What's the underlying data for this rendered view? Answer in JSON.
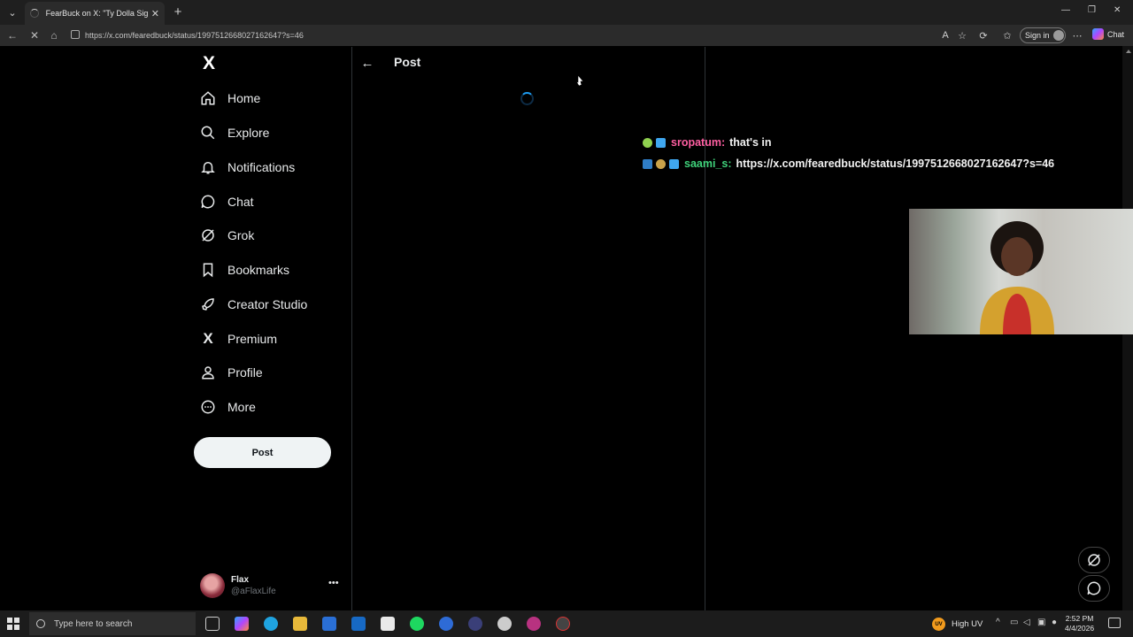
{
  "browser": {
    "tab_title": "FearBuck on X: \"Ty Dolla Sign calle",
    "url": "https://x.com/fearedbuck/status/1997512668027162647?s=46",
    "sign_in_label": "Sign in",
    "copilot_label": "Chat"
  },
  "sidebar": {
    "logo": "X",
    "items": [
      {
        "label": "Home",
        "icon": "home-icon"
      },
      {
        "label": "Explore",
        "icon": "search-icon"
      },
      {
        "label": "Notifications",
        "icon": "bell-icon"
      },
      {
        "label": "Chat",
        "icon": "chat-bubble-icon"
      },
      {
        "label": "Grok",
        "icon": "grok-icon"
      },
      {
        "label": "Bookmarks",
        "icon": "bookmark-icon"
      },
      {
        "label": "Creator Studio",
        "icon": "rocket-icon"
      },
      {
        "label": "Premium",
        "icon": "x-logo-icon"
      },
      {
        "label": "Profile",
        "icon": "person-icon"
      },
      {
        "label": "More",
        "icon": "more-circle-icon"
      }
    ],
    "post_button_label": "Post",
    "account": {
      "display_name": "Flax",
      "handle": "@aFlaxLife"
    }
  },
  "main": {
    "header_title": "Post"
  },
  "stream_chat": [
    {
      "user": "sropatum",
      "separator": ":",
      "message": "that's in",
      "user_color": "#ff5fa2"
    },
    {
      "user": "saami_s",
      "separator": ":",
      "message": "https://x.com/fearedbuck/status/1997512668027162647?s=46",
      "user_color": "#3fd17a"
    }
  ],
  "taskbar": {
    "search_placeholder": "Type here to search",
    "weather_label": "High UV",
    "weather_badge": "UV",
    "time": "2:52 PM",
    "date": "4/4/2026"
  }
}
